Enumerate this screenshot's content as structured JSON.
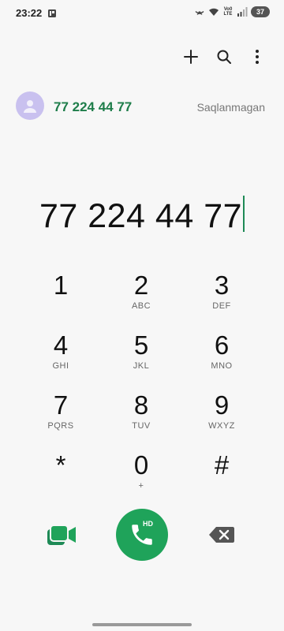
{
  "status_bar": {
    "time": "23:22",
    "network_label": "Vo0 LTE",
    "battery": "37"
  },
  "top_actions": {
    "icons": [
      "plus-icon",
      "search-icon",
      "more-vert-icon"
    ]
  },
  "suggestion": {
    "number": "77 224 44 77",
    "status": "Saqlanmagan"
  },
  "dial": {
    "number": "77 224 44 77"
  },
  "keypad": {
    "keys": [
      {
        "digit": "1",
        "letters": ""
      },
      {
        "digit": "2",
        "letters": "ABC"
      },
      {
        "digit": "3",
        "letters": "DEF"
      },
      {
        "digit": "4",
        "letters": "GHI"
      },
      {
        "digit": "5",
        "letters": "JKL"
      },
      {
        "digit": "6",
        "letters": "MNO"
      },
      {
        "digit": "7",
        "letters": "PQRS"
      },
      {
        "digit": "8",
        "letters": "TUV"
      },
      {
        "digit": "9",
        "letters": "WXYZ"
      },
      {
        "digit": "*",
        "letters": ""
      },
      {
        "digit": "0",
        "letters": "+"
      },
      {
        "digit": "#",
        "letters": ""
      }
    ]
  },
  "call": {
    "badge": "HD"
  },
  "colors": {
    "accent_green": "#1fa35a",
    "number_green": "#1e7d4a",
    "avatar_bg": "#c9c1ef"
  }
}
